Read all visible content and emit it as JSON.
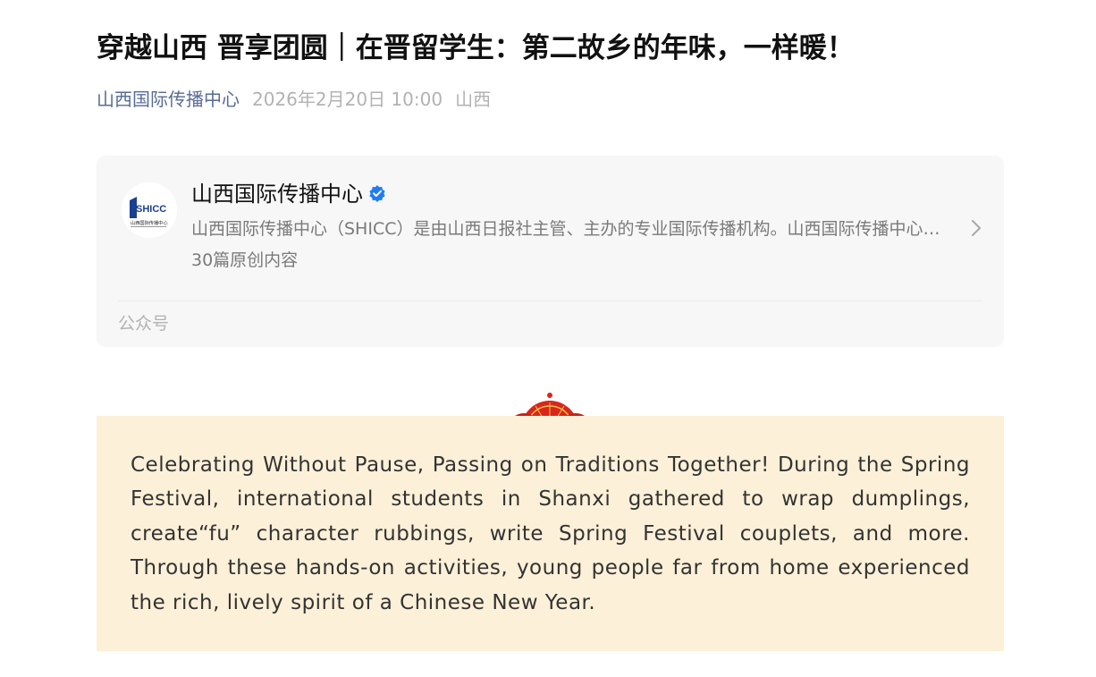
{
  "article": {
    "title": "穿越山西 晋享团圆｜在晋留学生：第二故乡的年味，一样暖！",
    "author": "山西国际传播中心",
    "date": "2026年2月20日 10:00",
    "region": "山西"
  },
  "account_card": {
    "logo_text": "SHICC",
    "logo_subtext": "山西国际传播中心",
    "name": "山西国际传播中心",
    "description": "山西国际传播中心（SHICC）是由山西日报社主管、主办的专业国际传播机构。山西国际传播中心立足山西，面向世界",
    "original_count": "30篇原创内容",
    "type_label": "公众号"
  },
  "content": {
    "paragraph": "Celebrating Without Pause, Passing on Traditions Together! During the Spring Festival, international students in Shanxi gathered to wrap dumplings, create“fu” character rubbings, write Spring Festival couplets, and more. Through these hands-on activities, young people far from home experienced the rich, lively spirit of a Chinese New Year."
  },
  "icons": {
    "verified": "verified-badge-icon",
    "chevron": "chevron-right-icon",
    "fan": "red-fan-decoration-icon"
  },
  "colors": {
    "author_link": "#576b95",
    "meta_gray": "#b2b2b2",
    "card_bg": "#f7f7f7",
    "content_bg": "#fdf0d8",
    "verified_blue": "#1f7cf3",
    "fan_red": "#d9261c",
    "logo_blue": "#1b3f8f",
    "logo_red": "#d6242a"
  }
}
